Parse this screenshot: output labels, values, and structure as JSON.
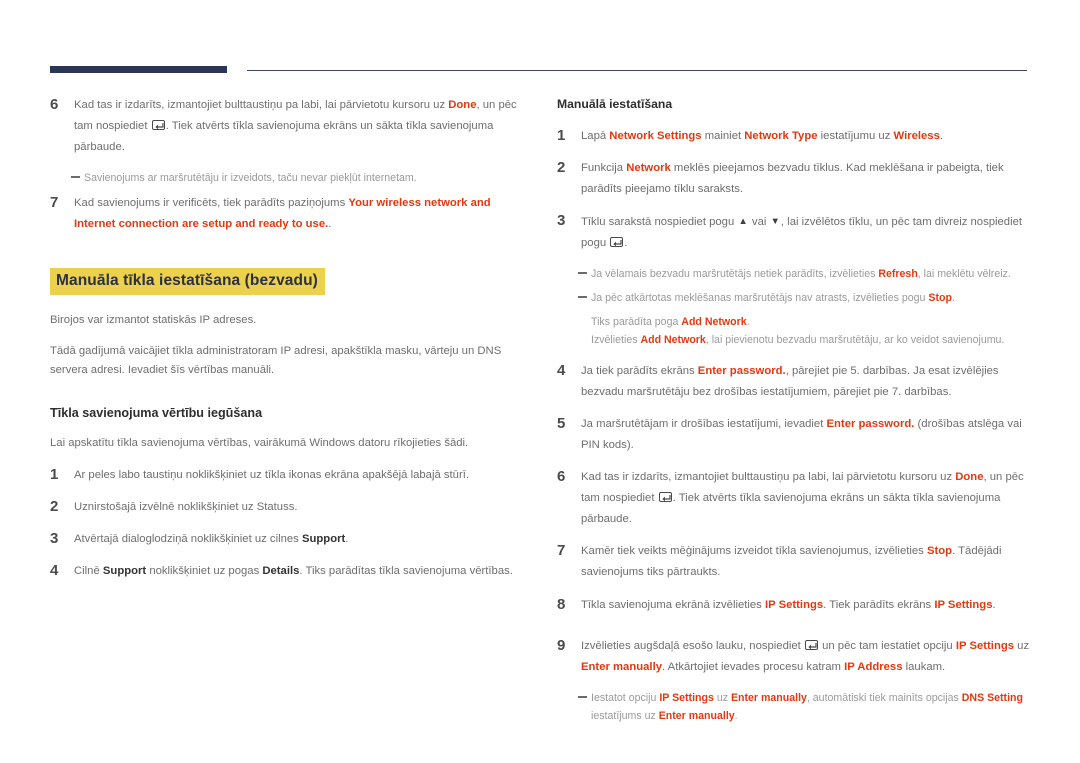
{
  "accent": {
    "ui_term_color": "#e5380f",
    "highlight_color": "#ecd14c",
    "rule_color": "#2b3555",
    "body_text_color": "#6e6e6e",
    "note_text_color": "#9a9a9a"
  },
  "icons": {
    "enter_key": "enter-key-icon",
    "arrow_up": "▲",
    "arrow_down": "▼"
  },
  "left_column": {
    "step6": {
      "number": "6",
      "text_a": "Kad tas ir izdarīts, izmantojiet bulttaustiņu pa labi, lai pārvietotu kursoru uz ",
      "term_done": "Done",
      "text_b": ", un pēc tam nospiediet ",
      "text_c": ". Tiek atvērts tīkla savienojuma ekrāns un sākta tīkla savienojuma pārbaude."
    },
    "note6": "Savienojums ar maršrutētāju ir izveidots, taču nevar piekļūt internetam.",
    "step7": {
      "number": "7",
      "text_a": "Kad savienojums ir verificēts, tiek parādīts paziņojums ",
      "term_message": "Your wireless network and Internet connection are setup and ready to use.",
      "text_b": "."
    },
    "section_title": "Manuāla tīkla iestatīšana (bezvadu)",
    "para1": "Birojos var izmantot statiskās IP adreses.",
    "para2": "Tādā gadījumā vaicājiet tīkla administratoram IP adresi, apakštīkla masku, vārteju un DNS servera adresi. Ievadiet šīs vērtības manuāli.",
    "sub_title": "Tīkla savienojuma vērtību iegūšana",
    "para3": "Lai apskatītu tīkla savienojuma vērtības, vairākumā Windows datoru rīkojieties šādi.",
    "sub_step1": {
      "number": "1",
      "text": "Ar peles labo taustiņu noklikšķiniet uz tīkla ikonas ekrāna apakšējā labajā stūrī."
    },
    "sub_step2": {
      "number": "2",
      "text": "Uznirstošajā izvēlnē noklikšķiniet uz Statuss."
    },
    "sub_step3": {
      "number": "3",
      "text_a": "Atvērtajā dialoglodziņā noklikšķiniet uz cilnes ",
      "term_support": "Support",
      "text_b": "."
    },
    "sub_step4": {
      "number": "4",
      "text_a": "Cilnē ",
      "term_support": "Support",
      "text_b": " noklikšķiniet uz pogas ",
      "term_details": "Details",
      "text_c": ". Tiks parādītas tīkla savienojuma vērtības."
    }
  },
  "right_column": {
    "title": "Manuālā iestatīšana",
    "step1": {
      "number": "1",
      "text_a": "Lapā ",
      "term_network_settings": "Network Settings",
      "text_b": " mainiet ",
      "term_network_type": "Network Type",
      "text_c": " iestatījumu uz ",
      "term_wireless": "Wireless",
      "text_d": "."
    },
    "step2": {
      "number": "2",
      "text_a": "Funkcija ",
      "term_network": "Network",
      "text_b": " meklēs pieejamos bezvadu tīklus. Kad meklēšana ir pabeigta, tiek parādīts pieejamo tīklu saraksts."
    },
    "step3": {
      "number": "3",
      "text_a": "Tīklu sarakstā nospiediet pogu ",
      "text_b": " vai ",
      "text_c": ", lai izvēlētos tīklu, un pēc tam divreiz nospiediet pogu ",
      "text_d": "."
    },
    "note3a": {
      "text_a": "Ja vēlamais bezvadu maršrutētājs netiek parādīts, izvēlieties ",
      "term_refresh": "Refresh",
      "text_b": ", lai meklētu vēlreiz."
    },
    "note3b": {
      "text_a": "Ja pēc atkārtotas meklēšanas maršrutētājs nav atrasts, izvēlieties pogu ",
      "term_stop": "Stop",
      "text_b": ".",
      "line2_a": "Tiks parādīta poga ",
      "line2_term": "Add Network",
      "line2_b": ".",
      "line3_a": "Izvēlieties ",
      "line3_term": "Add Network",
      "line3_b": ", lai pievienotu bezvadu maršrutētāju, ar ko veidot savienojumu."
    },
    "step4": {
      "number": "4",
      "text_a": "Ja tiek parādīts ekrāns ",
      "term_enter_password": "Enter password.",
      "text_b": ", pārejiet pie 5. darbības. Ja esat izvēlējies bezvadu maršrutētāju bez drošības iestatījumiem, pārejiet pie 7. darbības."
    },
    "step5": {
      "number": "5",
      "text_a": "Ja maršrutētājam ir drošības iestatījumi, ievadiet ",
      "term_enter_password": "Enter password.",
      "text_b": " (drošības atslēga vai PIN kods)."
    },
    "step6": {
      "number": "6",
      "text_a": "Kad tas ir izdarīts, izmantojiet bulttaustiņu pa labi, lai pārvietotu kursoru uz ",
      "term_done": "Done",
      "text_b": ", un pēc tam nospiediet ",
      "text_c": ". Tiek atvērts tīkla savienojuma ekrāns un sākta tīkla savienojuma pārbaude."
    },
    "step7": {
      "number": "7",
      "text_a": "Kamēr tiek veikts mēģinājums izveidot tīkla savienojumus, izvēlieties ",
      "term_stop": "Stop",
      "text_b": ". Tādējādi savienojums tiks pārtraukts."
    },
    "step8": {
      "number": "8",
      "text_a": "Tīkla savienojuma ekrānā izvēlieties ",
      "term_ip_settings_1": "IP Settings",
      "text_b": ". Tiek parādīts ekrāns ",
      "term_ip_settings_2": "IP Settings",
      "text_c": "."
    },
    "step9": {
      "number": "9",
      "text_a": "Izvēlieties augšdaļā esošo lauku, nospiediet ",
      "text_b": " un pēc tam iestatiet opciju ",
      "term_ip_settings": "IP Settings",
      "text_c": " uz ",
      "term_enter_manually": "Enter manually",
      "text_d": ". Atkārtojiet ievades procesu katram ",
      "term_ip_address": "IP Address",
      "text_e": " laukam."
    },
    "note9": {
      "text_a": "Iestatot opciju ",
      "term_ip_settings": "IP Settings",
      "text_b": " uz ",
      "term_enter_manually_1": "Enter manually",
      "text_c": ", automātiski tiek mainīts opcijas ",
      "term_dns_setting": "DNS Setting",
      "text_d": " iestatījums uz ",
      "term_enter_manually_2": "Enter manually",
      "text_e": "."
    }
  }
}
